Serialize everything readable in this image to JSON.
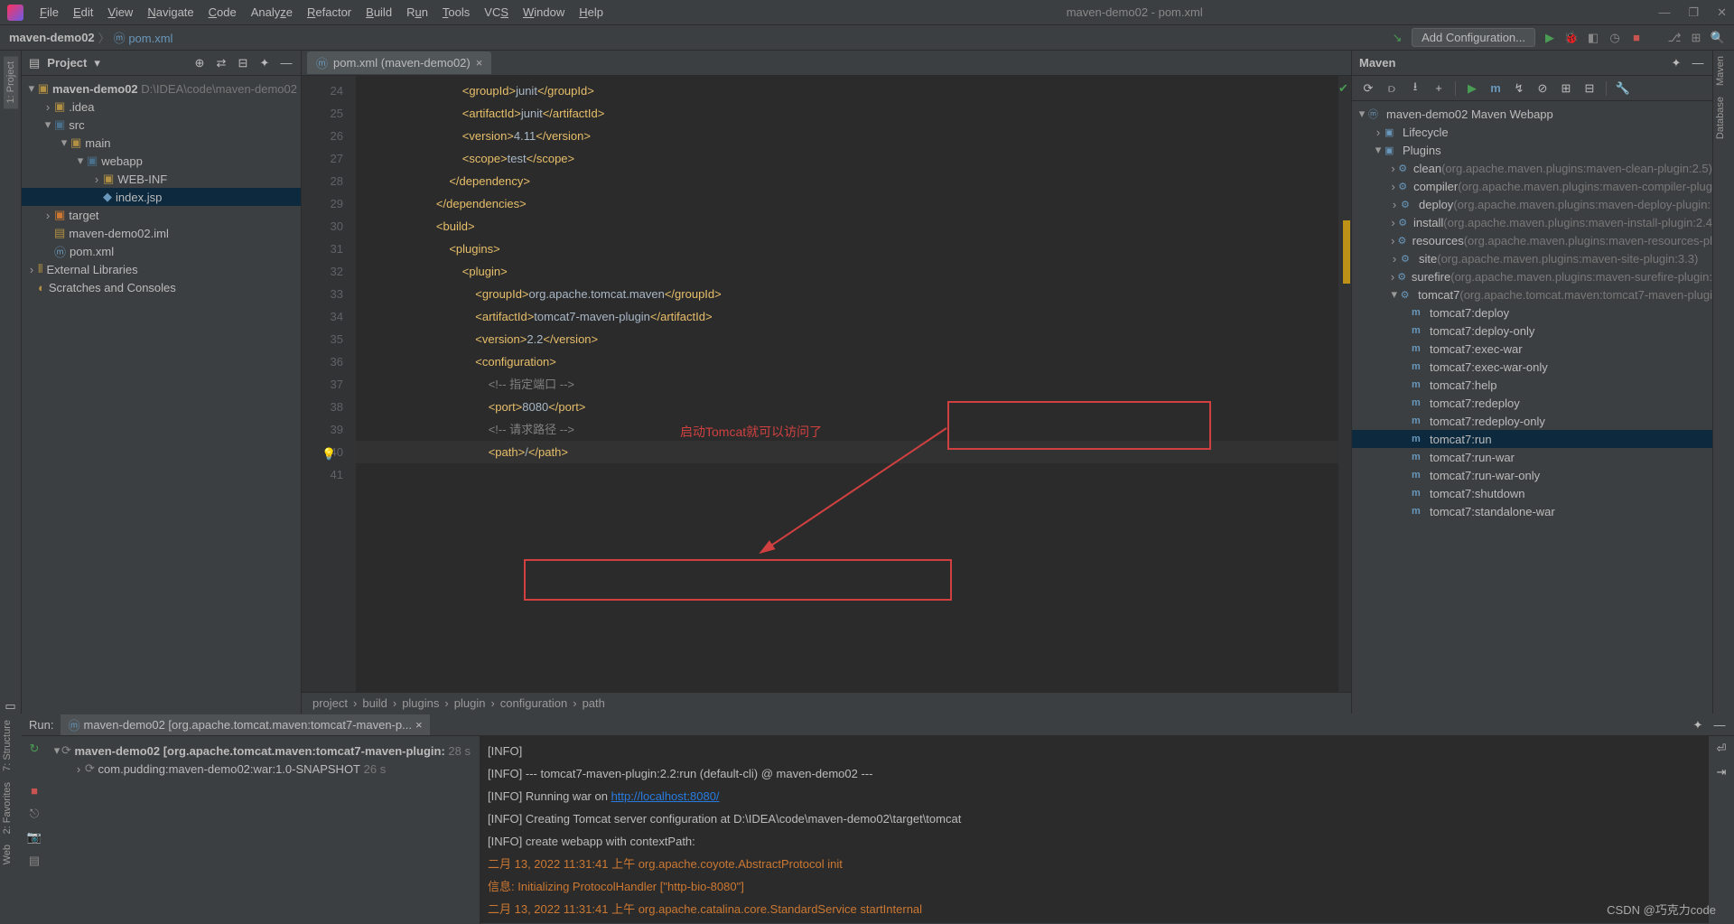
{
  "window": {
    "title": "maven-demo02 - pom.xml"
  },
  "menu": [
    "File",
    "Edit",
    "View",
    "Navigate",
    "Code",
    "Analyze",
    "Refactor",
    "Build",
    "Run",
    "Tools",
    "VCS",
    "Window",
    "Help"
  ],
  "breadcrumbs": {
    "project": "maven-demo02",
    "file": "pom.xml"
  },
  "addConfig": "Add Configuration...",
  "projectPanel": {
    "title": "Project",
    "root": "maven-demo02",
    "rootPath": "D:\\IDEA\\code\\maven-demo02",
    "idea": ".idea",
    "src": "src",
    "main": "main",
    "webapp": "webapp",
    "webinf": "WEB-INF",
    "index": "index.jsp",
    "target": "target",
    "iml": "maven-demo02.iml",
    "pom": "pom.xml",
    "extLib": "External Libraries",
    "scratch": "Scratches and Consoles"
  },
  "editor": {
    "tabLabel": "pom.xml (maven-demo02)",
    "startLine": 24,
    "lines": [
      "                <groupId>junit</groupId>",
      "                <artifactId>junit</artifactId>",
      "                <version>4.11</version>",
      "                <scope>test</scope>",
      "            </dependency>",
      "        </dependencies>",
      "",
      "        <build>",
      "            <plugins>",
      "                <plugin>",
      "                    <groupId>org.apache.tomcat.maven</groupId>",
      "                    <artifactId>tomcat7-maven-plugin</artifactId>",
      "                    <version>2.2</version>",
      "                    <configuration>",
      "                        <!-- 指定端口 -->",
      "                        <port>8080</port>",
      "                        <!-- 请求路径 -->",
      "                        <path>/</path>"
    ],
    "crumb": [
      "project",
      "build",
      "plugins",
      "plugin",
      "configuration",
      "path"
    ]
  },
  "maven": {
    "title": "Maven",
    "root": "maven-demo02 Maven Webapp",
    "lifecycle": "Lifecycle",
    "plugins": "Plugins",
    "pluginList": [
      {
        "name": "clean",
        "desc": "(org.apache.maven.plugins:maven-clean-plugin:2.5)"
      },
      {
        "name": "compiler",
        "desc": "(org.apache.maven.plugins:maven-compiler-plug"
      },
      {
        "name": "deploy",
        "desc": "(org.apache.maven.plugins:maven-deploy-plugin:"
      },
      {
        "name": "install",
        "desc": "(org.apache.maven.plugins:maven-install-plugin:2.4"
      },
      {
        "name": "resources",
        "desc": "(org.apache.maven.plugins:maven-resources-pl"
      },
      {
        "name": "site",
        "desc": "(org.apache.maven.plugins:maven-site-plugin:3.3)"
      },
      {
        "name": "surefire",
        "desc": "(org.apache.maven.plugins:maven-surefire-plugin:"
      },
      {
        "name": "tomcat7",
        "desc": "(org.apache.tomcat.maven:tomcat7-maven-plugi"
      }
    ],
    "goals": [
      "tomcat7:deploy",
      "tomcat7:deploy-only",
      "tomcat7:exec-war",
      "tomcat7:exec-war-only",
      "tomcat7:help",
      "tomcat7:redeploy",
      "tomcat7:redeploy-only",
      "tomcat7:run",
      "tomcat7:run-war",
      "tomcat7:run-war-only",
      "tomcat7:shutdown",
      "tomcat7:standalone-war"
    ]
  },
  "run": {
    "title": "Run:",
    "tab": "maven-demo02 [org.apache.tomcat.maven:tomcat7-maven-p...",
    "tree1": "maven-demo02 [org.apache.tomcat.maven:tomcat7-maven-plugin:",
    "tree1time": "28 s",
    "tree2": "com.pudding:maven-demo02:war:1.0-SNAPSHOT",
    "tree2time": "26 s",
    "console": [
      {
        "t": "[INFO] ",
        "c": ""
      },
      {
        "t": "[INFO] --- tomcat7-maven-plugin:2.2:run (default-cli) @ maven-demo02 ---",
        "c": ""
      },
      {
        "t": "[INFO] Running war on ",
        "link": "http://localhost:8080/",
        "c": ""
      },
      {
        "t": "[INFO] Creating Tomcat server configuration at D:\\IDEA\\code\\maven-demo02\\target\\tomcat",
        "c": ""
      },
      {
        "t": "[INFO] create webapp with contextPath:",
        "c": ""
      },
      {
        "t": "二月 13, 2022 11:31:41 上午 org.apache.coyote.AbstractProtocol init",
        "c": "red"
      },
      {
        "t": "信息: Initializing ProtocolHandler [\"http-bio-8080\"]",
        "c": "red"
      },
      {
        "t": "二月 13, 2022 11:31:41 上午 org.apache.catalina.core.StandardService startInternal",
        "c": "red"
      }
    ]
  },
  "annotation": "启动Tomcat就可以访问了",
  "watermark": "CSDN @巧克力code"
}
